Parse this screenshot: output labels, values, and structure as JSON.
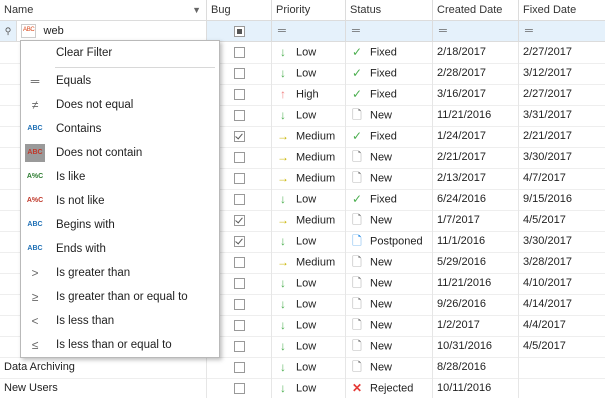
{
  "columns": [
    {
      "label": "Name"
    },
    {
      "label": "Bug"
    },
    {
      "label": "Priority"
    },
    {
      "label": "Status"
    },
    {
      "label": "Created Date"
    },
    {
      "label": "Fixed Date"
    }
  ],
  "filter": {
    "name_value": "web",
    "placeholder": "═"
  },
  "menu_items": [
    {
      "label": "Clear Filter",
      "icon": "none"
    },
    {
      "label": "Equals",
      "icon": "equals-icon"
    },
    {
      "label": "Does not equal",
      "icon": "not-equal-icon"
    },
    {
      "label": "Contains",
      "icon": "contains-icon"
    },
    {
      "label": "Does not contain",
      "icon": "not-contain-icon",
      "selected": true
    },
    {
      "label": "Is like",
      "icon": "like-icon"
    },
    {
      "label": "Is not like",
      "icon": "not-like-icon"
    },
    {
      "label": "Begins with",
      "icon": "begins-with-icon"
    },
    {
      "label": "Ends with",
      "icon": "ends-with-icon"
    },
    {
      "label": "Is greater than",
      "icon": "greater-than-icon"
    },
    {
      "label": "Is greater than or equal to",
      "icon": "greater-equal-icon"
    },
    {
      "label": "Is less than",
      "icon": "less-than-icon"
    },
    {
      "label": "Is less than or equal to",
      "icon": "less-equal-icon"
    }
  ],
  "rows": [
    {
      "name": "",
      "bug": false,
      "priority": "Low",
      "status": "Fixed",
      "created": "2/18/2017",
      "fixed": "2/27/2017"
    },
    {
      "name": "",
      "bug": false,
      "priority": "Low",
      "status": "Fixed",
      "created": "2/28/2017",
      "fixed": "3/12/2017"
    },
    {
      "name": "",
      "bug": false,
      "priority": "High",
      "status": "Fixed",
      "created": "3/16/2017",
      "fixed": "2/27/2017"
    },
    {
      "name": "",
      "bug": false,
      "priority": "Low",
      "status": "New",
      "created": "11/21/2016",
      "fixed": "3/31/2017"
    },
    {
      "name": "",
      "bug": true,
      "priority": "Medium",
      "status": "Fixed",
      "created": "1/24/2017",
      "fixed": "2/21/2017"
    },
    {
      "name": "",
      "bug": false,
      "priority": "Medium",
      "status": "New",
      "created": "2/21/2017",
      "fixed": "3/30/2017"
    },
    {
      "name": "",
      "bug": false,
      "priority": "Medium",
      "status": "New",
      "created": "2/13/2017",
      "fixed": "4/7/2017"
    },
    {
      "name": "",
      "bug": false,
      "priority": "Low",
      "status": "Fixed",
      "created": "6/24/2016",
      "fixed": "9/15/2016"
    },
    {
      "name": "",
      "bug": true,
      "priority": "Medium",
      "status": "New",
      "created": "1/7/2017",
      "fixed": "4/5/2017"
    },
    {
      "name": "",
      "bug": true,
      "priority": "Low",
      "status": "Postponed",
      "created": "11/1/2016",
      "fixed": "3/30/2017"
    },
    {
      "name": "",
      "bug": false,
      "priority": "Medium",
      "status": "New",
      "created": "5/29/2016",
      "fixed": "3/28/2017"
    },
    {
      "name": "",
      "bug": false,
      "priority": "Low",
      "status": "New",
      "created": "11/21/2016",
      "fixed": "4/10/2017"
    },
    {
      "name": "",
      "bug": false,
      "priority": "Low",
      "status": "New",
      "created": "9/26/2016",
      "fixed": "4/14/2017"
    },
    {
      "name": "",
      "bug": false,
      "priority": "Low",
      "status": "New",
      "created": "1/2/2017",
      "fixed": "4/4/2017"
    },
    {
      "name": "",
      "bug": false,
      "priority": "Low",
      "status": "New",
      "created": "10/31/2016",
      "fixed": "4/5/2017"
    },
    {
      "name": "Data Archiving",
      "bug": false,
      "priority": "Low",
      "status": "New",
      "created": "8/28/2016",
      "fixed": ""
    },
    {
      "name": "New Users",
      "bug": false,
      "priority": "Low",
      "status": "Rejected",
      "created": "10/11/2016",
      "fixed": ""
    }
  ],
  "colors": {
    "accent_green": "#4caf50",
    "high_red": "#f08080",
    "medium_yellow": "#c8b400",
    "filter_row_bg": "#e5f1fb",
    "rejected_red": "#e53935",
    "postponed_blue": "#1e88e5"
  }
}
